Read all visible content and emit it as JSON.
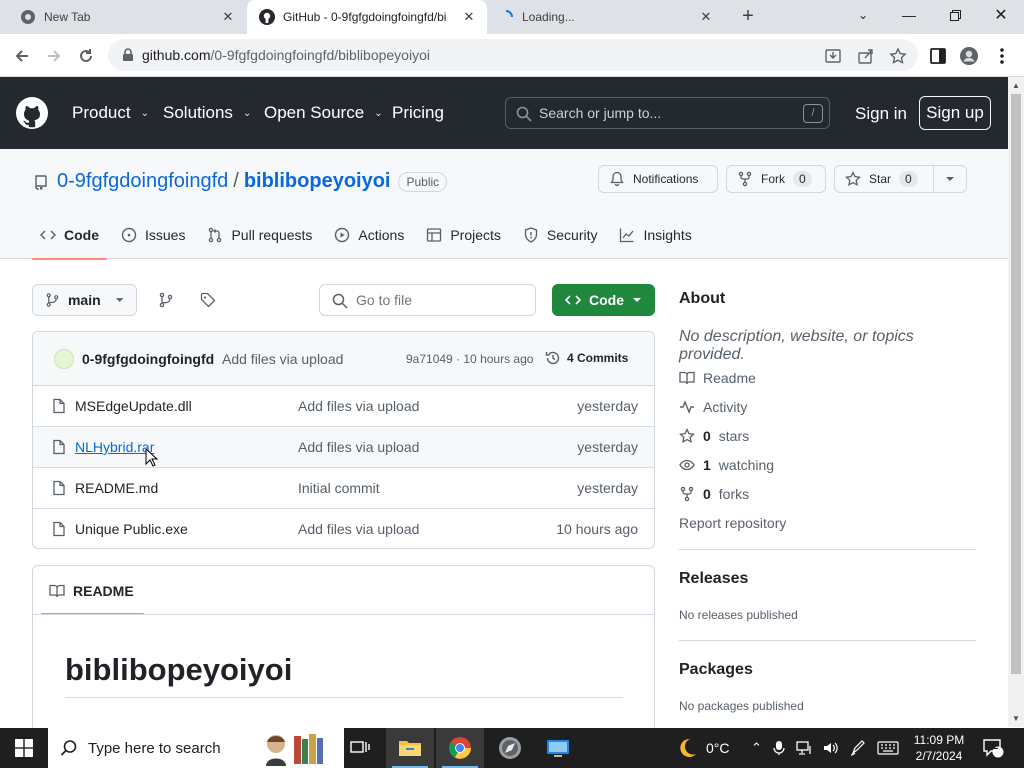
{
  "browser": {
    "tabs": [
      {
        "title": "New Tab",
        "active": false
      },
      {
        "title": "GitHub - 0-9fgfgdoingfoingfd/bi",
        "active": true
      },
      {
        "title": "Loading...",
        "active": false
      }
    ],
    "url_host": "github.com",
    "url_path": "/0-9fgfgdoingfoingfd/biblibopeyoiyoi"
  },
  "gh": {
    "nav": [
      "Product",
      "Solutions",
      "Open Source",
      "Pricing"
    ],
    "search_placeholder": "Search or jump to...",
    "search_shortcut": "/",
    "sign_in": "Sign in",
    "sign_up": "Sign up"
  },
  "repo": {
    "owner": "0-9fgfgdoingfoingfd",
    "separator": "/",
    "name": "biblibopeyoiyoi",
    "visibility": "Public",
    "notifications_label": "Notifications",
    "fork_label": "Fork",
    "fork_count": "0",
    "star_label": "Star",
    "star_count": "0",
    "tabs": [
      "Code",
      "Issues",
      "Pull requests",
      "Actions",
      "Projects",
      "Security",
      "Insights"
    ]
  },
  "filenav": {
    "branch": "main",
    "goto_placeholder": "Go to file",
    "code_label": "Code"
  },
  "commit": {
    "author": "0-9fgfgdoingfoingfd",
    "message": "Add files via upload",
    "sha_time": "9a71049 · 10 hours ago",
    "commits": "4 Commits"
  },
  "files": [
    {
      "name": "MSEdgeUpdate.dll",
      "message": "Add files via upload",
      "date": "yesterday"
    },
    {
      "name": "NLHybrid.rar",
      "message": "Add files via upload",
      "date": "yesterday"
    },
    {
      "name": "README.md",
      "message": "Initial commit",
      "date": "yesterday"
    },
    {
      "name": "Unique Public.exe",
      "message": "Add files via upload",
      "date": "10 hours ago"
    }
  ],
  "readme": {
    "tab_label": "README",
    "heading": "biblibopeyoiyoi"
  },
  "about": {
    "title": "About",
    "description": "No description, website, or topics provided.",
    "readme": "Readme",
    "activity": "Activity",
    "stars_count": "0",
    "stars_label": "stars",
    "watching_count": "1",
    "watching_label": "watching",
    "forks_count": "0",
    "forks_label": "forks",
    "report": "Report repository"
  },
  "releases": {
    "title": "Releases",
    "empty": "No releases published"
  },
  "packages": {
    "title": "Packages",
    "empty": "No packages published"
  },
  "taskbar": {
    "search_placeholder": "Type here to search",
    "weather": "0°C",
    "time": "11:09 PM",
    "date": "2/7/2024",
    "notifications_count": "2"
  }
}
